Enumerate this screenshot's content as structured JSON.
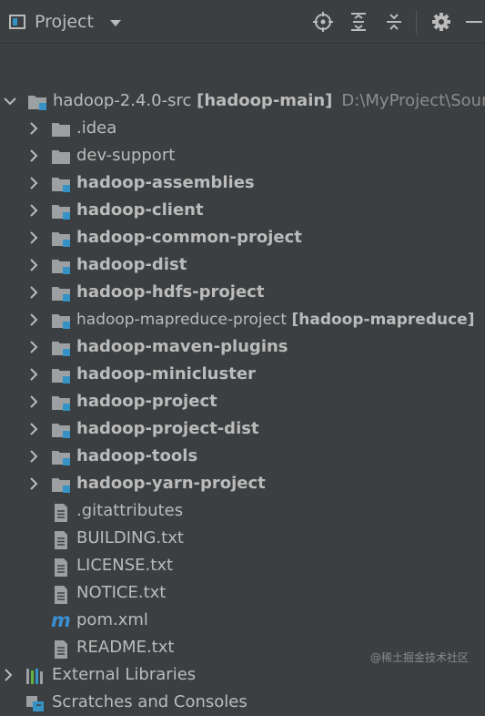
{
  "toolbar": {
    "title": "Project",
    "icons": [
      "locate-icon",
      "expand-all-icon",
      "collapse-all-icon",
      "settings-icon",
      "hide-icon"
    ]
  },
  "tree": {
    "root": {
      "name": "hadoop-2.4.0-src",
      "module": "[hadoop-main]",
      "path": "D:\\MyProject\\Source"
    },
    "items": [
      {
        "name": ".idea",
        "type": "folder",
        "bold": false
      },
      {
        "name": "dev-support",
        "type": "folder",
        "bold": false
      },
      {
        "name": "hadoop-assemblies",
        "type": "module",
        "bold": true
      },
      {
        "name": "hadoop-client",
        "type": "module",
        "bold": true
      },
      {
        "name": "hadoop-common-project",
        "type": "module",
        "bold": true
      },
      {
        "name": "hadoop-dist",
        "type": "module",
        "bold": true
      },
      {
        "name": "hadoop-hdfs-project",
        "type": "module",
        "bold": true
      },
      {
        "name": "hadoop-mapreduce-project",
        "type": "module",
        "bold": false,
        "suffix": "[hadoop-mapreduce]"
      },
      {
        "name": "hadoop-maven-plugins",
        "type": "module",
        "bold": true
      },
      {
        "name": "hadoop-minicluster",
        "type": "module",
        "bold": true
      },
      {
        "name": "hadoop-project",
        "type": "module",
        "bold": true
      },
      {
        "name": "hadoop-project-dist",
        "type": "module",
        "bold": true
      },
      {
        "name": "hadoop-tools",
        "type": "module",
        "bold": true
      },
      {
        "name": "hadoop-yarn-project",
        "type": "module",
        "bold": true
      }
    ],
    "files": [
      {
        "name": ".gitattributes",
        "type": "text"
      },
      {
        "name": "BUILDING.txt",
        "type": "text"
      },
      {
        "name": "LICENSE.txt",
        "type": "text"
      },
      {
        "name": "NOTICE.txt",
        "type": "text"
      },
      {
        "name": "pom.xml",
        "type": "maven"
      },
      {
        "name": "README.txt",
        "type": "text"
      }
    ],
    "external_libraries": "External Libraries",
    "scratches": "Scratches and Consoles"
  },
  "watermark": "@稀土掘金技术社区",
  "colors": {
    "background": "#3c3f41",
    "text": "#bbbbbb",
    "module_square": "#3592c4",
    "path": "#8c8c8c"
  }
}
